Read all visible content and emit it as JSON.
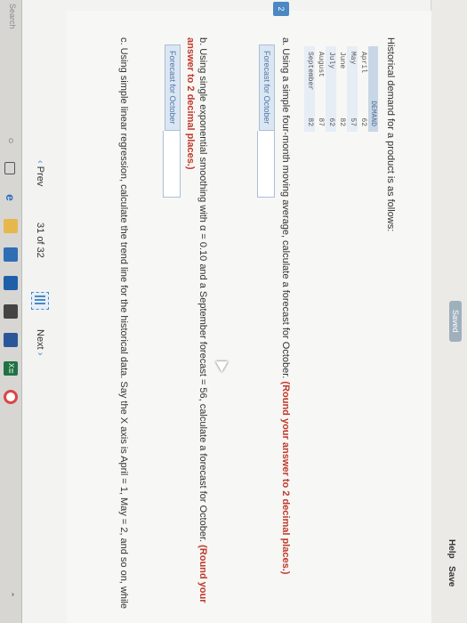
{
  "header": {
    "status_badge": "Saved",
    "help_label": "Help",
    "save_label": "Save"
  },
  "question": {
    "number": "2",
    "intro": "Historical demand for a product is as follows:",
    "table": {
      "header": "DEMAND",
      "rows": [
        {
          "month": "April",
          "demand": "62"
        },
        {
          "month": "May",
          "demand": "57"
        },
        {
          "month": "June",
          "demand": "82"
        },
        {
          "month": "July",
          "demand": "62"
        },
        {
          "month": "August",
          "demand": "87"
        },
        {
          "month": "September",
          "demand": "82"
        }
      ]
    },
    "part_a": {
      "text": "a. Using a simple four-month moving average, calculate a forecast for October.",
      "highlight": "(Round your answer to 2 decimal places.)",
      "label": "Forecast for October",
      "value": ""
    },
    "part_b": {
      "text": "b. Using single exponential smoothing with α = 0.10 and a September forecast = 56, calculate a forecast for October.",
      "highlight": "(Round your answer to 2 decimal places.)",
      "label": "Forecast for October",
      "value": ""
    },
    "part_c": {
      "text": "c. Using simple linear regression, calculate the trend line for the historical data. Say the X axis is April = 1, May = 2, and so on, while"
    }
  },
  "navigation": {
    "prev_label": "Prev",
    "current": "31",
    "of": "of",
    "total": "32",
    "next_label": "Next"
  },
  "taskbar": {
    "search_placeholder": "Search",
    "excel_label": "X≣"
  },
  "colors": {
    "accent": "#4b88c4",
    "answer_highlight": "#c0392b"
  }
}
